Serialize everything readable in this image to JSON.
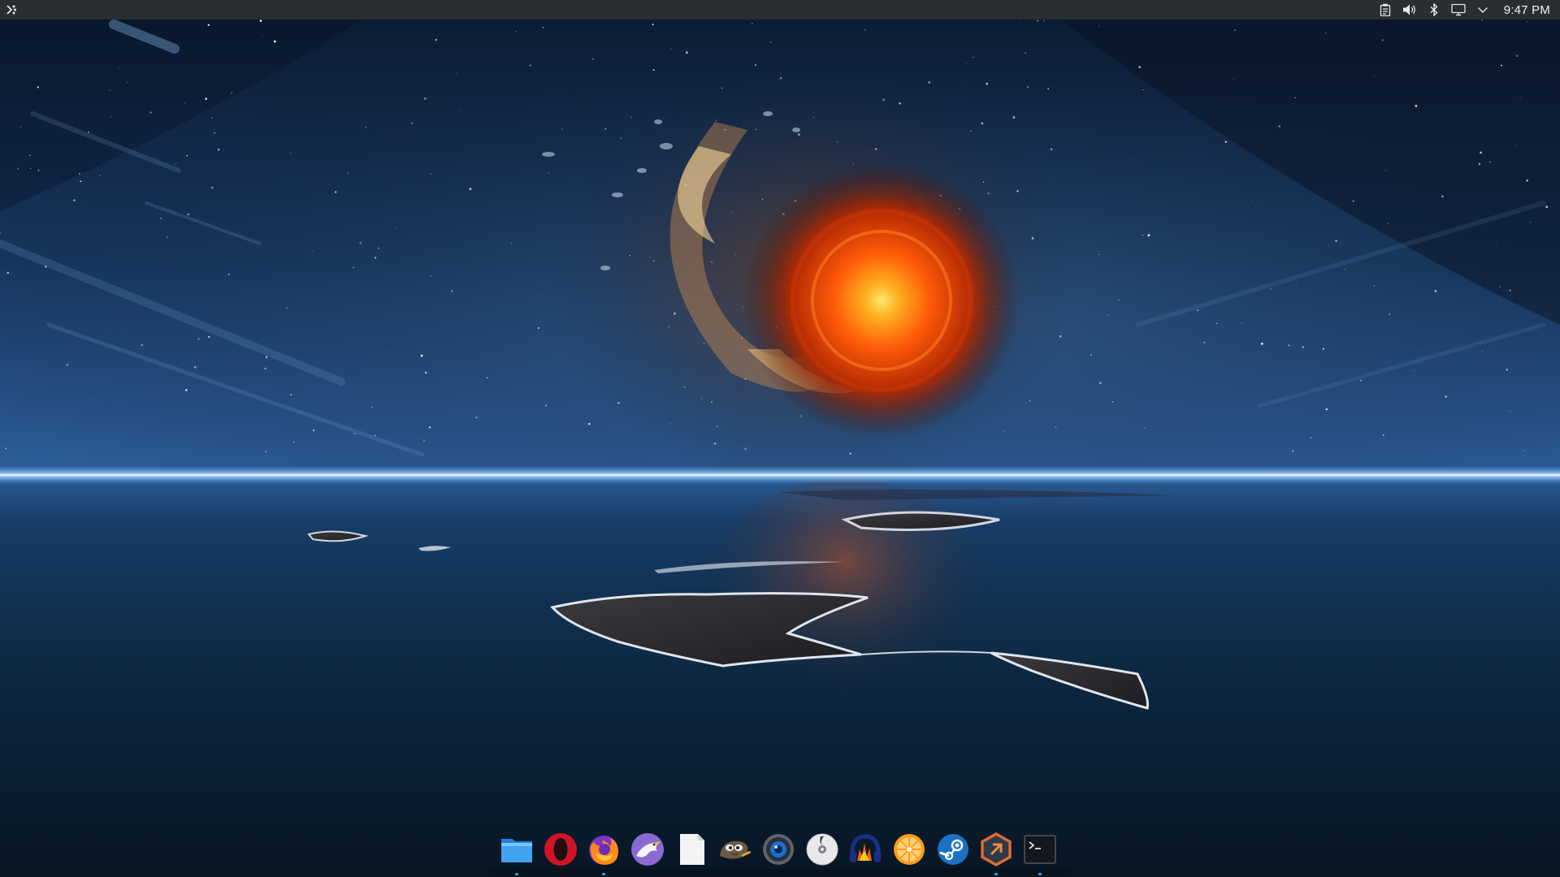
{
  "top_panel": {
    "launcher_icon": "kde-launcher-icon",
    "tray_icons": [
      "clipboard-icon",
      "volume-icon",
      "bluetooth-icon",
      "display-icon",
      "chevron-down-icon"
    ],
    "clock": "9:47 PM"
  },
  "wallpaper": {
    "description_icon": "space-vortex-ocean-wallpaper"
  },
  "dock": {
    "items": [
      {
        "icon": "file-manager-icon",
        "running": true
      },
      {
        "icon": "opera-icon",
        "running": false
      },
      {
        "icon": "firefox-icon",
        "running": true
      },
      {
        "icon": "email-eagle-icon",
        "running": false
      },
      {
        "icon": "text-document-icon",
        "running": false
      },
      {
        "icon": "gimp-icon",
        "running": false
      },
      {
        "icon": "webcam-icon",
        "running": false
      },
      {
        "icon": "disc-burner-icon",
        "running": false
      },
      {
        "icon": "audio-editor-icon",
        "running": false
      },
      {
        "icon": "orange-slice-icon",
        "running": false
      },
      {
        "icon": "steam-icon",
        "running": false
      },
      {
        "icon": "hex-app-icon",
        "running": true
      },
      {
        "icon": "terminal-icon",
        "running": true
      }
    ],
    "running_color": "#2f9cf5"
  },
  "colors": {
    "panel_bg": "#2a2d31",
    "horizon_glow": "#5aa8ff",
    "sun": "#ff6a10"
  }
}
